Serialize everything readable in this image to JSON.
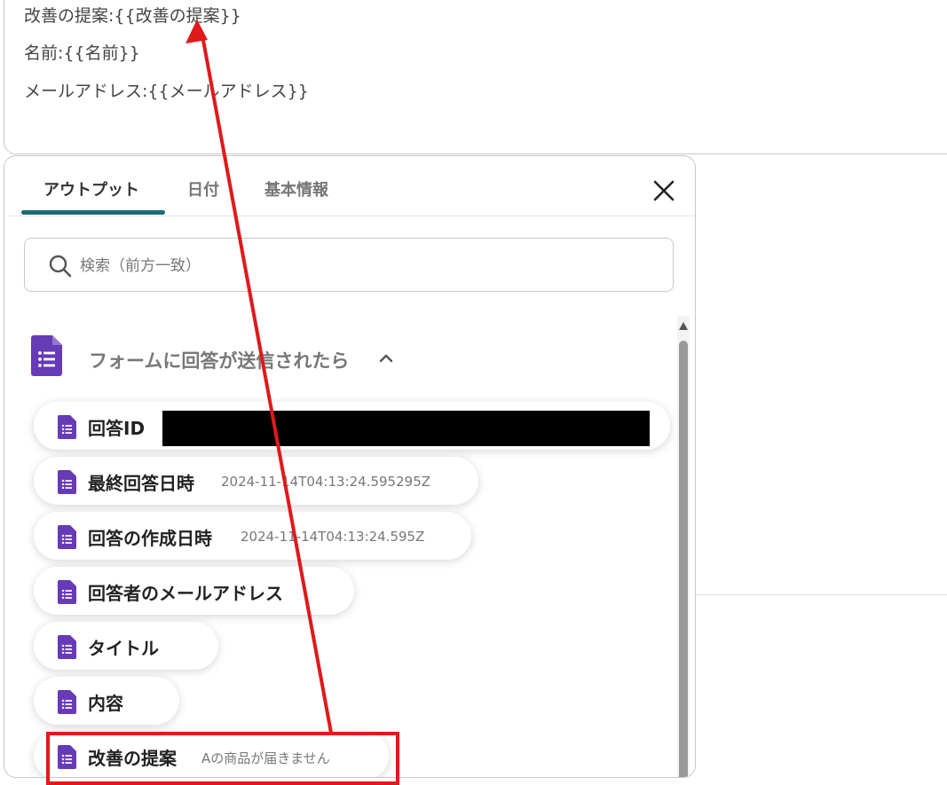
{
  "editor": {
    "lines": [
      "改善の提案:{{改善の提案}}",
      "名前:{{名前}}",
      "メールアドレス:{{メールアドレス}}"
    ]
  },
  "popup": {
    "tabs": [
      {
        "label": "アウトプット",
        "active": true
      },
      {
        "label": "日付",
        "active": false
      },
      {
        "label": "基本情報",
        "active": false
      }
    ],
    "close_icon": "close-icon",
    "search": {
      "placeholder": "検索（前方一致）",
      "value": "",
      "icon": "search-icon"
    },
    "group": {
      "title": "フォームに回答が送信されたら",
      "icon": "google-forms-icon",
      "expanded": true
    },
    "items": [
      {
        "label": "回答ID",
        "value": "",
        "redacted": true
      },
      {
        "label": "最終回答日時",
        "value": "2024-11-14T04:13:24.595295Z"
      },
      {
        "label": "回答の作成日時",
        "value": "2024-11-14T04:13:24.595Z"
      },
      {
        "label": "回答者のメールアドレス",
        "value": ""
      },
      {
        "label": "タイトル",
        "value": ""
      },
      {
        "label": "内容",
        "value": ""
      },
      {
        "label": "改善の提案",
        "value": "Aの商品が届きません",
        "highlighted": true
      }
    ]
  },
  "annotation": {
    "arrow_color": "#e0191b"
  },
  "colors": {
    "tab_accent": "#1b6a7a",
    "forms_purple": "#673ab7",
    "highlight": "#e0191b"
  }
}
